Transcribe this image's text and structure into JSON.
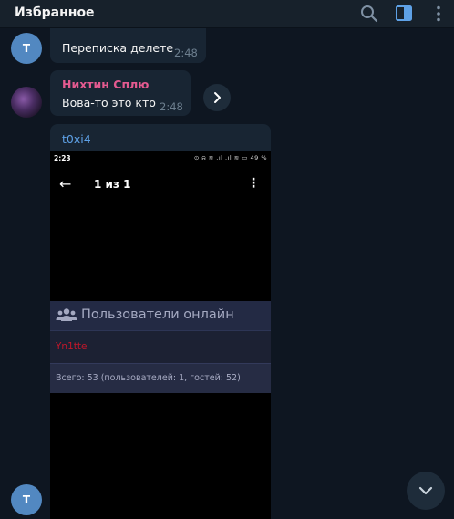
{
  "header": {
    "title": "Избранное",
    "icons": [
      "search-icon",
      "sidebar-toggle-icon",
      "more-vertical-icon"
    ],
    "accent": "#5ea1e6"
  },
  "messages": [
    {
      "avatar_letter": "Т",
      "text": "Переписка делете",
      "time": "2:48"
    },
    {
      "sender": "Нихтин Сплю",
      "sender_color": "#e45a90",
      "text": "Вова-то это кто",
      "time": "2:48"
    },
    {
      "sender": "t0xi4",
      "sender_color": "#5ea1e6",
      "image": {
        "status_time": "2:23",
        "status_icons": "⊙ ⍾ ≋ .ıl .ıl ≋ ▭ 49 %",
        "counter": "1 из 1",
        "panel_title": "Пользователи онлайн",
        "online_user": "Yn1tte",
        "total": "Всего: 53 (пользователей: 1, гостей: 52)"
      }
    }
  ],
  "footer_avatar_letter": "Т",
  "colors": {
    "background": "#0e1621",
    "bubble": "#182533",
    "avatar": "#5288c1",
    "online_user": "#c1172a"
  }
}
